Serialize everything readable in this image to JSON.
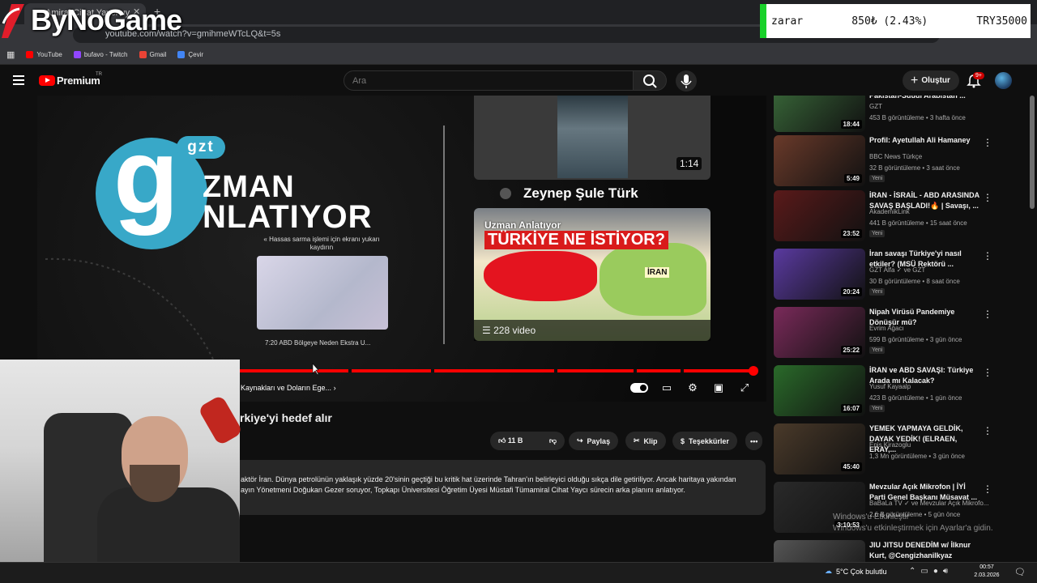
{
  "overlay": {
    "brand": "ByNoGame",
    "ticker": {
      "label": "zarar",
      "change": "850₺ (2.43%)",
      "target": "TRY35000"
    }
  },
  "browser": {
    "tab_title": "Amiral Cihat Yaycı uy",
    "url": "youtube.com/watch?v=gmihmeWTcLQ&t=5s",
    "bookmarks": [
      {
        "label": "YouTube",
        "color": "#ff0000"
      },
      {
        "label": "bufavo - Twitch",
        "color": "#9146ff"
      },
      {
        "label": "Gmail",
        "color": "#ea4335"
      },
      {
        "label": "Çevir",
        "color": "#4285f4"
      }
    ]
  },
  "youtube": {
    "logo_text": "Premium",
    "region": "TR",
    "search_placeholder": "Ara",
    "create_label": "Oluştur",
    "notif_badge": "9+"
  },
  "video": {
    "gzt_badge": "gzt",
    "big_letter": "g",
    "show_line1": "ZMAN",
    "show_line2": "NLATIYOR",
    "scroll_hint": "« Hassas sarma işlemi için ekranı yukarı kaydırın",
    "mini_title": "7:20  ABD Bölgeye Neden Ekstra U...",
    "card1_duration": "1:14",
    "card_channel": "Zeynep Şule Türk",
    "card2_show": "Uzman Anlatıyor",
    "card2_title": "TÜRKİYE NE İSTİYOR?",
    "card2_iran": "İRAN",
    "card2_count": "228 video",
    "chapter": "Kaynakları ve Doların Ege...",
    "progress": 1.0,
    "title": "rkiye'yi hedef alır",
    "like_count": "11 B",
    "share_label": "Paylaş",
    "clip_label": "Klip",
    "thanks_label": "Teşekkürler",
    "description_line1": "aktör İran. Dünya petrolünün yaklaşık yüzde 20'sinin geçtiği bu kritik hat üzerinde Tahran'ın belirleyici olduğu sıkça dile getiriliyor. Ancak haritaya yakından",
    "description_line2": "ayın Yönetmeni Doğukan Gezer soruyor, Topkapı Üniversitesi Öğretim Üyesi Müstafi Tümamiral Cihat Yaycı sürecin arka planını anlatıyor."
  },
  "recommendations": [
    {
      "title": "Pakistan-Suudi Arabistan ...",
      "channel": "GZT",
      "meta": "453 B görüntüleme • 3 hafta önce",
      "duration": "18:44",
      "new": "",
      "thumb": "#3a6a3a"
    },
    {
      "title": "Profil: Ayetullah Ali Hamaney",
      "channel": "BBC News Türkçe",
      "meta": "32 B görüntüleme • 3 saat önce",
      "duration": "5:49",
      "new": "Yeni",
      "thumb": "#6a3a2a"
    },
    {
      "title": "İRAN - İSRAİL - ABD ARASINDA SAVAŞ BAŞLADI!🔥 | Savaşı, ...",
      "channel": "AkademikLink",
      "meta": "441 B görüntüleme • 15 saat önce",
      "duration": "23:52",
      "new": "Yeni",
      "thumb": "#5a1a1a"
    },
    {
      "title": "İran savaşı Türkiye'yi nasıl etkiler? (MSÜ Rektörü ...",
      "channel": "GZT Alfa ✓ ve GZT",
      "meta": "30 B görüntüleme • 8 saat önce",
      "duration": "20:24",
      "new": "Yeni",
      "thumb": "#5a3aa0"
    },
    {
      "title": "Nipah Virüsü Pandemiye Dönüşür mü?",
      "channel": "Evrim Ağacı",
      "meta": "599 B görüntüleme • 3 gün önce",
      "duration": "25:22",
      "new": "Yeni",
      "thumb": "#7a2a5a"
    },
    {
      "title": "İRAN ve ABD SAVAŞI: Türkiye Arada mı Kalacak?",
      "channel": "Yusuf Kayaalp",
      "meta": "423 B görüntüleme • 1 gün önce",
      "duration": "16:07",
      "new": "Yeni",
      "thumb": "#2a6a2a"
    },
    {
      "title": "YEMEK YAPMAYA GELDİK, DAYAK YEDİK! (ELRAEN, ERAY,...",
      "channel": "Enis Kirazoglu",
      "meta": "1,3 Mn görüntüleme • 3 gün önce",
      "duration": "45:40",
      "new": "",
      "thumb": "#4a3a2a"
    },
    {
      "title": "Mevzular Açık Mikrofon | İYİ Parti Genel Başkanı Müsavat ...",
      "channel": "BaBaLa TV ✓ ve Mevzular Açık Mikrofo...",
      "meta": "2,6 B görüntüleme • 5 gün önce",
      "duration": "3:10:53",
      "new": "",
      "thumb": "#2a2a2a"
    },
    {
      "title": "JIU JITSU DENEDİM w/ İlknur Kurt, @Cengizhanilkyaz",
      "channel": "",
      "meta": "",
      "duration": "",
      "new": "",
      "thumb": "#555555"
    }
  ],
  "windows": {
    "watermark_line1": "Windows'u Etkinleştir",
    "watermark_line2": "Windows'u etkinleştirmek için Ayarlar'a gidin.",
    "weather": "5°C  Çok bulutlu",
    "time": "00:57",
    "date": "2.03.2026"
  }
}
